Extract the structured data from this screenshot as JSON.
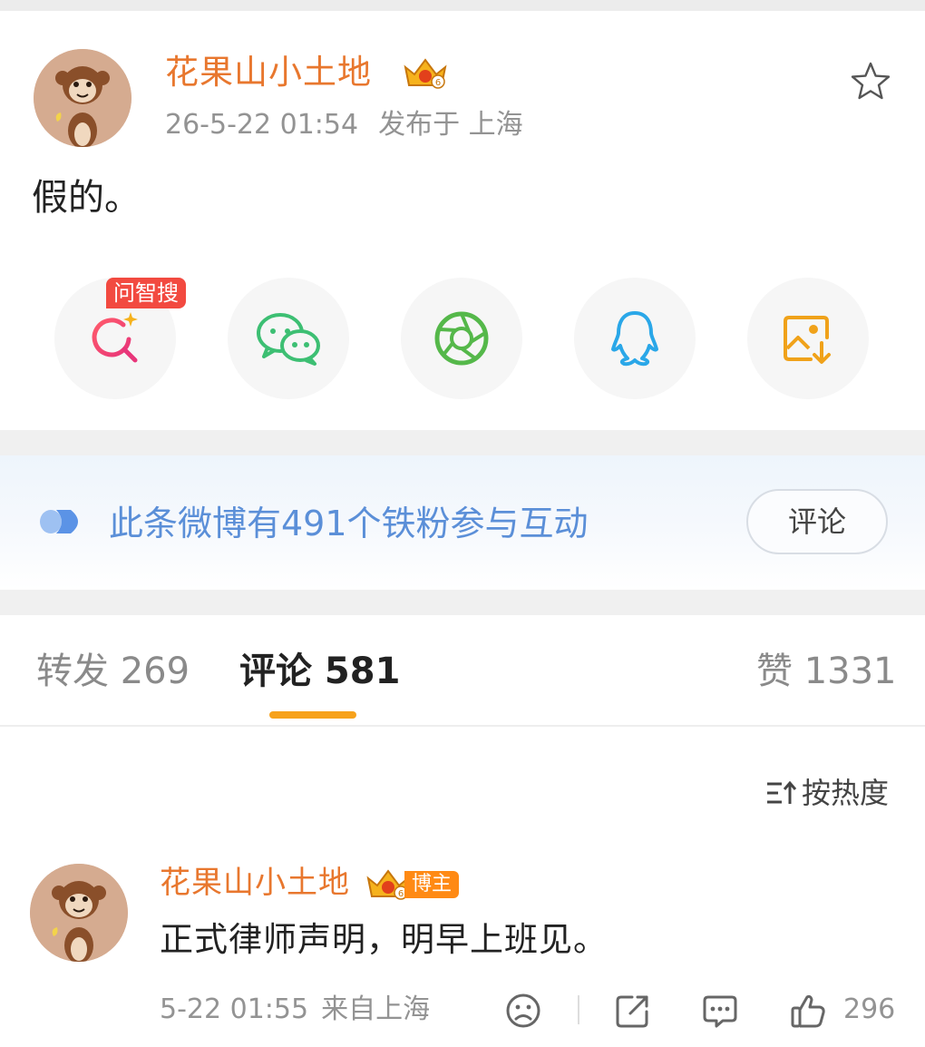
{
  "post": {
    "author": "花果山小土地",
    "date": "26-5-22 01:54",
    "location": "发布于 上海",
    "body": "假的。"
  },
  "share": {
    "ai_tag": "问智搜",
    "icons": [
      "ai-search-icon",
      "wechat-icon",
      "moments-icon",
      "qq-icon",
      "save-image-icon"
    ]
  },
  "fan_banner": {
    "text": "此条微博有491个铁粉参与互动",
    "button": "评论"
  },
  "tabs": {
    "repost": "转发 269",
    "comments": "评论 581",
    "likes": "赞 1331"
  },
  "sort": {
    "label": "按热度"
  },
  "comment": {
    "author": "花果山小土地",
    "badge": "博主",
    "text": "正式律师声明，明早上班见。",
    "date": "5-22 01:55",
    "location": "来自上海",
    "likes": "296"
  },
  "colors": {
    "author": "#e8772e",
    "fan_text": "#5b8fd8",
    "tab_indicator": "#f7a21b",
    "ai_tag": "#f24a40",
    "owner_badge": "#ff8a14"
  }
}
